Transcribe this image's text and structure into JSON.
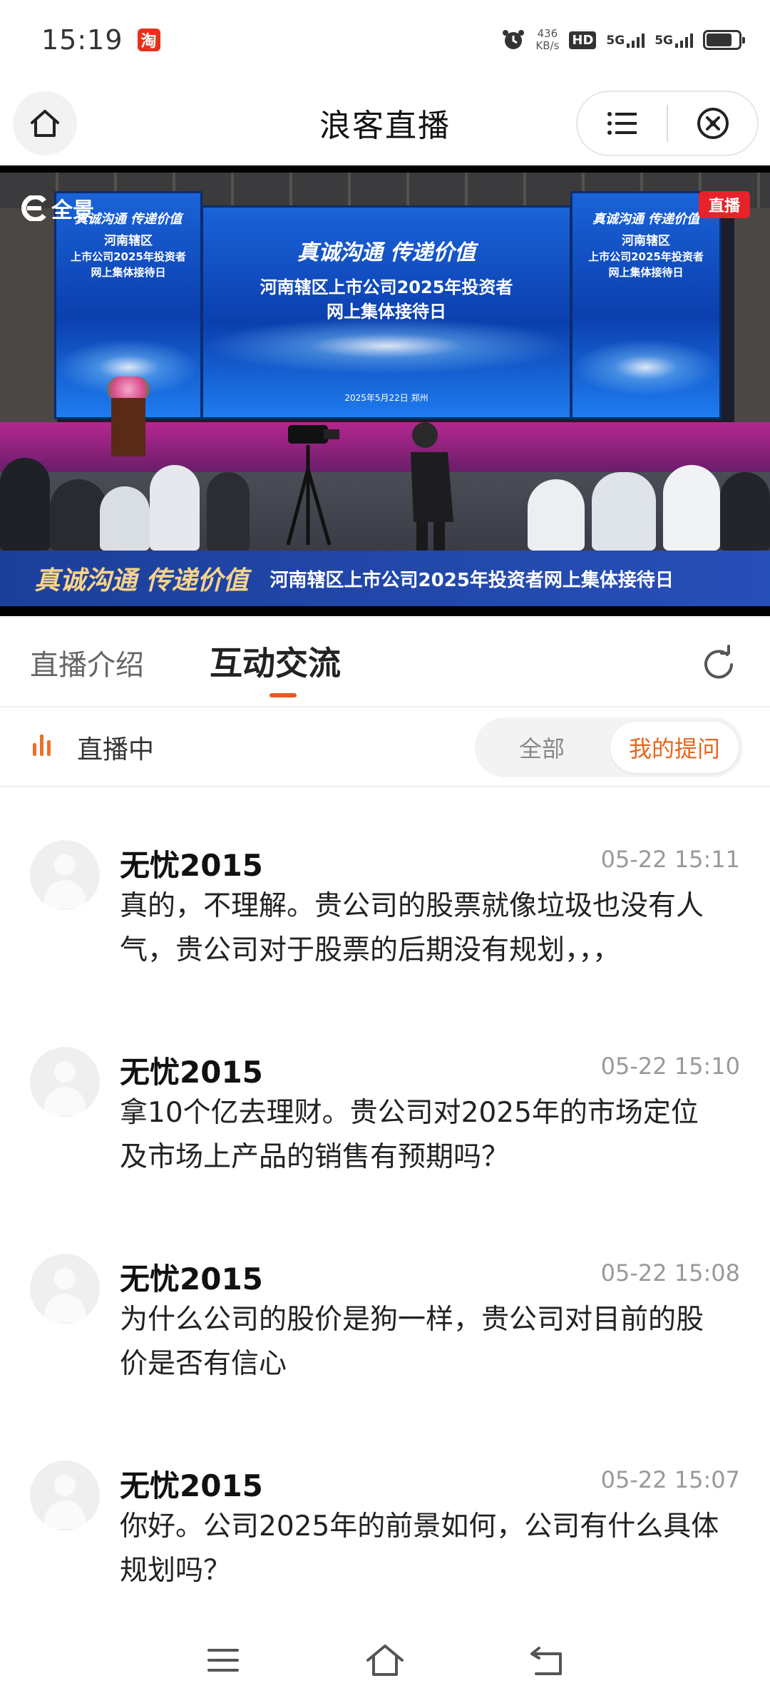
{
  "status_bar": {
    "time": "15:19",
    "app_badge": "淘",
    "net_speed_value": "436",
    "net_speed_unit": "KB/s",
    "hd_label": "HD",
    "sim1": "5G",
    "sim2": "5G",
    "battery_level": 0.8
  },
  "header": {
    "title": "浪客直播"
  },
  "video": {
    "logo_text": "全景",
    "live_tag": "直播",
    "slogan": "真诚沟通 传递价值",
    "headline_line1": "河南辖区上市公司2025年投资者",
    "headline_line2": "网上集体接待日",
    "side_line1": "河南辖区",
    "side_line2": "上市公司2025年投资者",
    "side_line3": "网上集体接待日",
    "date": "2025年5月22日  郑州",
    "banner_slogan": "真诚沟通 传递价值",
    "banner_text": "河南辖区上市公司2025年投资者网上集体接待日"
  },
  "tabs": [
    {
      "label": "直播介绍"
    },
    {
      "label": "互动交流"
    }
  ],
  "live_status": {
    "label": "直播中"
  },
  "filter": {
    "all": "全部",
    "mine": "我的提问"
  },
  "messages": [
    {
      "name": "无忧2015",
      "time": "05-22 15:11",
      "text": "真的，不理解。贵公司的股票就像垃圾也没有人气，贵公司对于股票的后期没有规划，，，"
    },
    {
      "name": "无忧2015",
      "time": "05-22 15:10",
      "text": "拿10个亿去理财。贵公司对2025年的市场定位及市场上产品的销售有预期吗？"
    },
    {
      "name": "无忧2015",
      "time": "05-22 15:08",
      "text": "为什么公司的股价是狗一样，贵公司对目前的股价是否有信心"
    },
    {
      "name": "无忧2015",
      "time": "05-22 15:07",
      "text": "你好。公司2025年的前景如何，公司有什么具体规划吗？"
    }
  ],
  "colors": {
    "accent": "#e8651e",
    "live_red": "#e8222a",
    "text_primary": "#111111",
    "text_secondary": "#999999"
  },
  "icons": {
    "home": "home-icon",
    "menu": "list-icon",
    "close": "close-circle-icon",
    "refresh": "refresh-icon",
    "nav_menu": "menu-icon",
    "nav_home": "home-icon",
    "nav_back": "back-icon"
  }
}
